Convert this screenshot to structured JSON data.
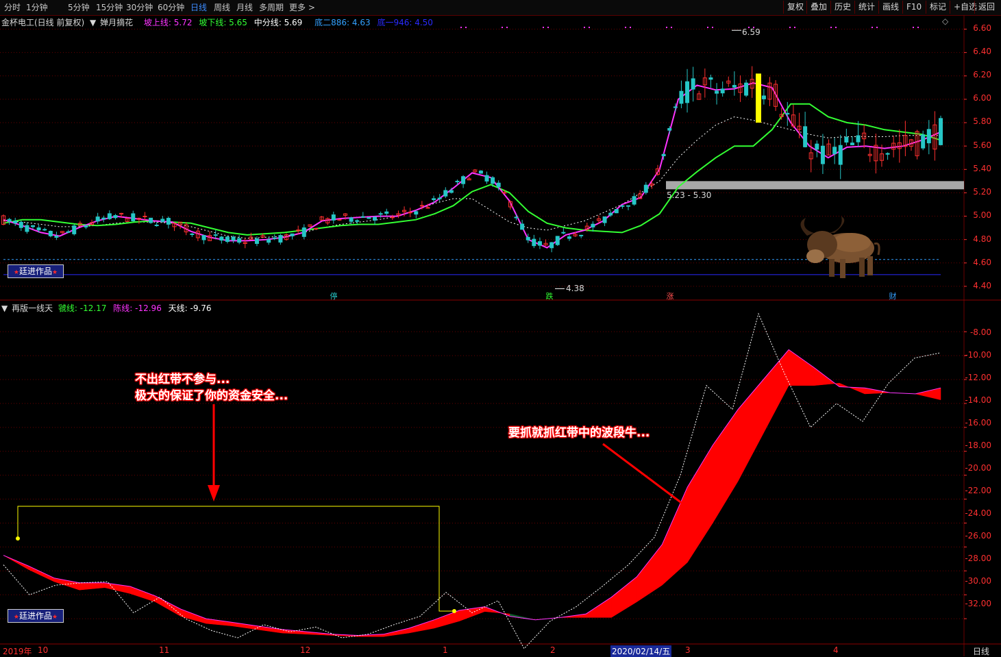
{
  "toolbar": {
    "periods": [
      "分时",
      "1分钟",
      "5分钟",
      "15分钟",
      "30分钟",
      "60分钟",
      "日线",
      "周线",
      "月线",
      "多周期",
      "更多 >"
    ],
    "active_period": "日线",
    "right_buttons": [
      "复权",
      "叠加",
      "历史",
      "统计",
      "画线",
      "F10",
      "标记",
      "+自选",
      "返回"
    ]
  },
  "upper": {
    "stock": "金杯电工(日线 前复权)",
    "indicator": "婵月摘花",
    "line1": {
      "label": "坡上线: 5.72",
      "color": "#ff33ff"
    },
    "line2": {
      "label": "坡下线: 5.65",
      "color": "#33ff33"
    },
    "line3": {
      "label": "中分线: 5.69",
      "color": "#ffffff"
    },
    "line4": {
      "label": "底二886: 4.63",
      "color": "#33a0ff"
    },
    "line5": {
      "label": "底一946: 4.50",
      "color": "#2a2aff"
    },
    "yticks": [
      "6.60",
      "6.40",
      "6.20",
      "6.00",
      "5.80",
      "5.60",
      "5.40",
      "5.20",
      "5.00",
      "4.80",
      "4.60",
      "4.40"
    ],
    "high_label": "6.59",
    "low_label": "4.38",
    "gap_label": "5.23 - 5.30",
    "event_markers": [
      "停",
      "跌",
      "涨",
      "财"
    ],
    "badge": "廷进作品"
  },
  "lower": {
    "indicator": "再版一线天",
    "line1": {
      "label": "虢线: -12.17",
      "color": "#ff33ff"
    },
    "line2": {
      "label": "陈线: -12.96",
      "color": "#33ff33"
    },
    "line3": {
      "label": "天线: -9.76",
      "color": "#ffffff"
    },
    "yticks": [
      "-8.00",
      "-10.00",
      "-12.00",
      "-14.00",
      "-16.00",
      "-18.00",
      "-20.00",
      "-22.00",
      "-24.00",
      "-26.00",
      "-28.00",
      "-30.00",
      "-32.00"
    ],
    "annotation1": [
      "不出红带不参与...",
      "极大的保证了你的资金安全..."
    ],
    "annotation2": "要抓就抓红带中的波段牛...",
    "badge": "廷进作品"
  },
  "xaxis": {
    "labels": [
      "2019年",
      "10",
      "11",
      "12",
      "1",
      "2",
      "2020/02/14/五",
      "3",
      "4"
    ],
    "period_label": "日线"
  },
  "colors": {
    "up": "#ff3030",
    "down": "#26c6c6",
    "grid": "#6a0000",
    "axis": "#ff3030",
    "redband": "#ff0000",
    "greenband": "#0d5a2a"
  },
  "chart_data": [
    {
      "type": "candlestick",
      "title": "金杯电工(日线 前复权)",
      "ylim": [
        4.3,
        6.65
      ],
      "x_range": [
        "2019-09",
        "2020-04"
      ],
      "key_points": [
        {
          "label": "high",
          "value": 6.59
        },
        {
          "label": "low",
          "value": 4.38
        },
        {
          "label": "gap_band",
          "value": [
            5.23,
            5.3
          ]
        }
      ],
      "series": [
        {
          "name": "坡上线",
          "color": "#ff33ff",
          "values": [
            4.97,
            4.92,
            4.86,
            4.83,
            4.9,
            4.96,
            5.0,
            4.98,
            4.96,
            4.95,
            4.87,
            4.82,
            4.79,
            4.79,
            4.8,
            4.82,
            4.86,
            4.96,
            4.98,
            4.99,
            5.0,
            5.0,
            5.05,
            5.12,
            5.24,
            5.37,
            5.33,
            5.13,
            4.8,
            4.73,
            4.84,
            4.88,
            4.96,
            5.1,
            5.16,
            5.4,
            6.0,
            6.12,
            6.08,
            6.09,
            6.14,
            6.1,
            5.8,
            5.6,
            5.5,
            5.59,
            5.6,
            5.58,
            5.6,
            5.65,
            5.72
          ]
        },
        {
          "name": "坡下线",
          "color": "#33ff33",
          "values": [
            4.94,
            4.97,
            4.97,
            4.95,
            4.93,
            4.92,
            4.93,
            4.95,
            4.96,
            4.95,
            4.94,
            4.9,
            4.86,
            4.84,
            4.85,
            4.86,
            4.88,
            4.9,
            4.92,
            4.93,
            4.93,
            4.95,
            4.97,
            5.02,
            5.09,
            5.21,
            5.27,
            5.2,
            5.04,
            4.94,
            4.9,
            4.88,
            4.87,
            4.86,
            4.92,
            5.02,
            5.25,
            5.38,
            5.5,
            5.6,
            5.6,
            5.74,
            5.96,
            5.96,
            5.85,
            5.8,
            5.78,
            5.74,
            5.72,
            5.7,
            5.65
          ]
        },
        {
          "name": "中分线",
          "color": "#ffffff",
          "values": [
            4.96,
            4.95,
            4.93,
            4.91,
            4.91,
            4.92,
            4.94,
            4.95,
            4.95,
            4.94,
            4.91,
            4.87,
            4.83,
            4.81,
            4.82,
            4.83,
            4.86,
            4.9,
            4.93,
            4.95,
            4.97,
            5.0,
            5.05,
            5.11,
            5.15,
            5.15,
            5.05,
            4.95,
            4.9,
            4.88,
            4.92,
            4.96,
            5.03,
            5.1,
            5.2,
            5.3,
            5.5,
            5.65,
            5.78,
            5.85,
            5.82,
            5.78,
            5.74,
            5.7,
            5.67,
            5.68,
            5.68,
            5.68,
            5.69,
            5.69,
            5.69
          ]
        },
        {
          "name": "底二886",
          "color": "#33a0ff",
          "values": [
            4.63
          ]
        },
        {
          "name": "底一946",
          "color": "#2a2aff",
          "values": [
            4.5
          ]
        }
      ]
    },
    {
      "type": "area",
      "title": "再版一线天",
      "ylim": [
        -34,
        -6.5
      ],
      "series": [
        {
          "name": "虢线",
          "color": "#ff33ff",
          "values": [
            -26.7,
            -27.6,
            -28.6,
            -29.0,
            -29.0,
            -29.3,
            -30.1,
            -31.2,
            -32.0,
            -32.3,
            -32.6,
            -32.9,
            -33.1,
            -33.3,
            -33.4,
            -33.3,
            -32.8,
            -32.1,
            -31.3,
            -31.0,
            -31.8,
            -32.1,
            -31.9,
            -31.6,
            -30.2,
            -28.5,
            -25.8,
            -21.0,
            -17.5,
            -14.5,
            -12.0,
            -9.5,
            -11.0,
            -12.6,
            -12.7,
            -13.1,
            -13.2,
            -12.7
          ]
        },
        {
          "name": "陈线",
          "color": "#33ff33",
          "values": [
            -26.7,
            -27.9,
            -28.9,
            -29.6,
            -29.4,
            -29.9,
            -30.6,
            -31.8,
            -32.4,
            -32.6,
            -32.9,
            -33.2,
            -33.3,
            -33.4,
            -33.5,
            -33.5,
            -33.2,
            -32.8,
            -32.2,
            -31.4,
            -31.6,
            -32.1,
            -31.9,
            -31.9,
            -31.9,
            -30.6,
            -29.2,
            -27.3,
            -24.0,
            -20.5,
            -16.5,
            -12.5,
            -12.5,
            -12.3,
            -13.2,
            -13.1,
            -13.2,
            -13.7
          ]
        },
        {
          "name": "天线",
          "color": "#ffffff",
          "values": [
            -27.5,
            -30.0,
            -29.2,
            -29.0,
            -28.9,
            -31.5,
            -30.2,
            -32.0,
            -33.0,
            -33.6,
            -32.5,
            -33.1,
            -32.7,
            -33.6,
            -33.3,
            -32.5,
            -31.8,
            -29.8,
            -31.5,
            -30.5,
            -34.5,
            -32.2,
            -31.0,
            -29.3,
            -27.5,
            -25.2,
            -20.0,
            -12.5,
            -14.5,
            -6.5,
            -11.5,
            -16.0,
            -14.0,
            -15.5,
            -12.3,
            -10.2,
            -9.76
          ]
        }
      ]
    }
  ]
}
